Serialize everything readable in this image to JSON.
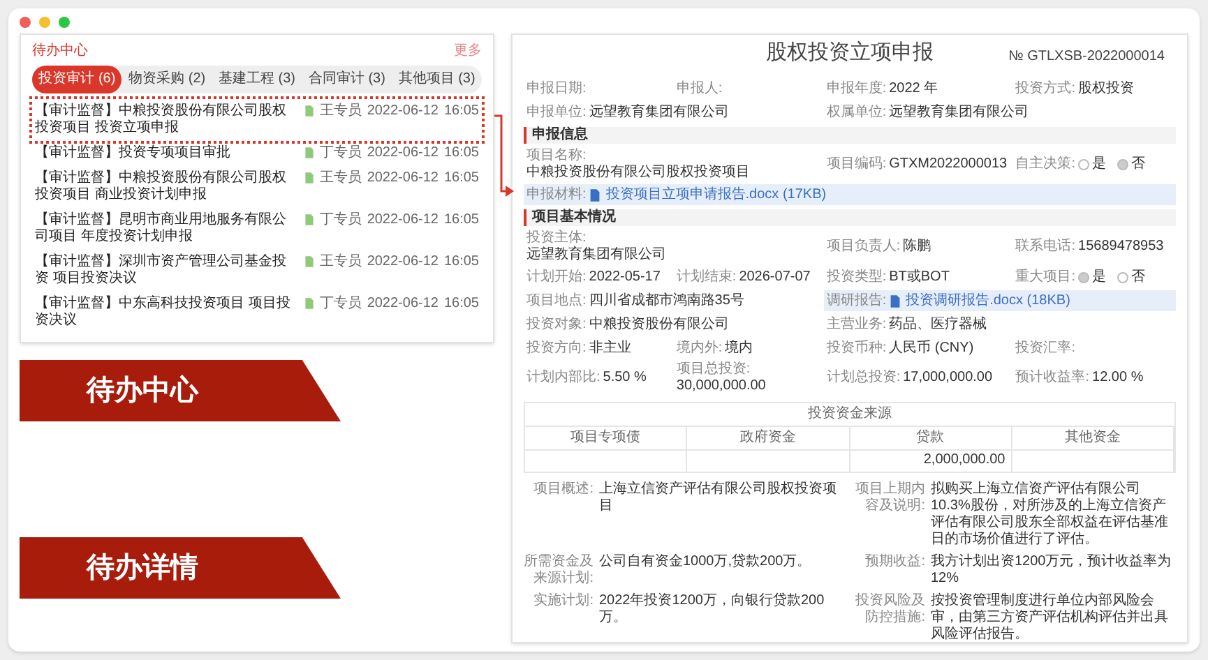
{
  "todo_center": {
    "title": "待办中心",
    "more": "更多",
    "tabs": [
      {
        "label": "投资审计 (6)",
        "selected": true
      },
      {
        "label": "物资采购 (2)",
        "selected": false
      },
      {
        "label": "基建工程 (3)",
        "selected": false
      },
      {
        "label": "合同审计 (3)",
        "selected": false
      },
      {
        "label": "其他项目 (3)",
        "selected": false
      }
    ],
    "rows": [
      {
        "title": "【审计监督】中粮投资股份有限公司股权投资项目 投资立项申报",
        "person": "王专员",
        "date": "2022-06-12",
        "time": "16:05",
        "highlighted": true
      },
      {
        "title": "【审计监督】投资专项项目审批",
        "person": "丁专员",
        "date": "2022-06-12",
        "time": "16:05",
        "highlighted": false
      },
      {
        "title": "【审计监督】中粮投资股份有限公司股权投资项目 商业投资计划申报",
        "person": "王专员",
        "date": "2022-06-12",
        "time": "16:05",
        "highlighted": false
      },
      {
        "title": "【审计监督】昆明市商业用地服务有限公司项目 年度投资计划申报",
        "person": "丁专员",
        "date": "2022-06-12",
        "time": "16:05",
        "highlighted": false
      },
      {
        "title": "【审计监督】深圳市资产管理公司基金投资 项目投资决议",
        "person": "王专员",
        "date": "2022-06-12",
        "time": "16:05",
        "highlighted": false
      },
      {
        "title": "【审计监督】中东高科技投资项目 项目投资决议",
        "person": "丁专员",
        "date": "2022-06-12",
        "time": "16:05",
        "highlighted": false
      }
    ]
  },
  "labels": [
    "待办中心",
    "待办详情"
  ],
  "detail": {
    "title": "股权投资立项申报",
    "number": "№ GTLXSB-2022000014",
    "header_rows": [
      [
        {
          "kind": "text",
          "label": "申报日期:"
        },
        {
          "kind": "text",
          "label": "申报人:"
        },
        {
          "kind": "text",
          "label": "申报年度:",
          "value": "2022 年"
        },
        {
          "kind": "text",
          "label": "投资方式:",
          "value": "股权投资"
        }
      ],
      [
        {
          "kind": "text",
          "label": "申报单位:",
          "value": "远望教育集团有限公司"
        },
        {
          "kind": "text",
          "label": "权属单位:",
          "value": "远望教育集团有限公司"
        }
      ]
    ],
    "sections": [
      {
        "title": "申报信息",
        "rows": [
          [
            {
              "kind": "text",
              "label": "项目名称:",
              "value": "中粮投资股份有限公司股权投资项目"
            },
            {
              "kind": "blank"
            },
            {
              "kind": "text",
              "label": "项目编码:",
              "value": "GTXM2022000013"
            },
            {
              "kind": "radio",
              "label": "自主决策:",
              "options": [
                {
                  "label": "是",
                  "selected": false
                },
                {
                  "label": "否",
                  "selected": true
                }
              ]
            }
          ],
          [
            {
              "kind": "file",
              "label": "申报材料:",
              "value": "投资项目立项申请报告.docx (17KB)"
            }
          ]
        ]
      },
      {
        "title": "项目基本情况",
        "rows": [
          [
            {
              "kind": "text",
              "label": "投资主体:",
              "value": "远望教育集团有限公司"
            },
            {
              "kind": "blank"
            },
            {
              "kind": "text",
              "label": "项目负责人:",
              "value": "陈鹏"
            },
            {
              "kind": "text",
              "label": "联系电话:",
              "value": "15689478953"
            }
          ],
          [
            {
              "kind": "text",
              "label": "计划开始:",
              "value": "2022-05-17"
            },
            {
              "kind": "text",
              "label": "计划结束:",
              "value": "2026-07-07"
            },
            {
              "kind": "text",
              "label": "投资类型:",
              "value": "BT或BOT"
            },
            {
              "kind": "radio",
              "label": "重大项目:",
              "options": [
                {
                  "label": "是",
                  "selected": true
                },
                {
                  "label": "否",
                  "selected": false
                }
              ]
            }
          ],
          [
            {
              "kind": "text",
              "label": "项目地点:",
              "value": "四川省成都市鸿南路35号"
            },
            {
              "kind": "file",
              "label": "调研报告:",
              "value": "投资调研报告.docx (18KB)"
            }
          ],
          [
            {
              "kind": "text",
              "label": "投资对象:",
              "value": "中粮投资股份有限公司"
            },
            {
              "kind": "text",
              "label": "主营业务:",
              "value": "药品、医疗器械"
            }
          ],
          [
            {
              "kind": "text",
              "label": "投资方向:",
              "value": "非主业"
            },
            {
              "kind": "text",
              "label": "境内外:",
              "value": "境内"
            },
            {
              "kind": "text",
              "label": "投资币种:",
              "value": "人民币 (CNY)"
            },
            {
              "kind": "text",
              "label": "投资汇率:"
            }
          ],
          [
            {
              "kind": "text",
              "label": "计划内部比:",
              "value": "5.50 %"
            },
            {
              "kind": "text",
              "label": "项目总投资:",
              "value": "30,000,000.00"
            },
            {
              "kind": "text",
              "label": "计划总投资:",
              "value": "17,000,000.00"
            },
            {
              "kind": "text",
              "label": "预计收益率:",
              "value": "12.00 %"
            }
          ]
        ]
      }
    ],
    "funding": {
      "title": "投资资金来源",
      "columns": [
        "项目专项债",
        "政府资金",
        "贷款",
        "其他资金"
      ],
      "cells": [
        {},
        {},
        {
          "value": "2,000,000.00"
        },
        {}
      ]
    },
    "notes": [
      {
        "label": "项目概述:",
        "value": "上海立信资产评估有限公司股权投资项目"
      },
      {
        "label": "项目上期内容及说明:",
        "value": "拟购买上海立信资产评估有限公司10.3%股份，对所涉及的上海立信资产评估有限公司股东全部权益在评估基准日的市场价值进行了评估。"
      },
      {
        "label": "所需资金及来源计划:",
        "value": "公司自有资金1000万,贷款200万。"
      },
      {
        "label": "预期收益:",
        "value": "我方计划出资1200万元，预计收益率为12%"
      },
      {
        "label": "实施计划:",
        "value": "2022年投资1200万，向银行贷款200万。"
      },
      {
        "label": "投资风险及防控措施:",
        "value": "按投资管理制度进行单位内部风险会审，由第三方资产评估机构评估并出具风险评估报告。"
      }
    ]
  }
}
